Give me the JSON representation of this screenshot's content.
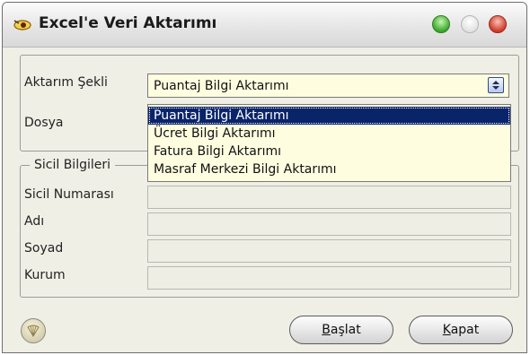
{
  "window": {
    "title": "Excel'e Veri Aktarımı"
  },
  "transfer": {
    "label": "Aktarım Şekli",
    "selected": "Puantaj Bilgi Aktarımı",
    "options": [
      "Puantaj Bilgi Aktarımı",
      "Ücret Bilgi Aktarımı",
      "Fatura Bilgi Aktarımı",
      "Masraf Merkezi Bilgi Aktarımı"
    ]
  },
  "file": {
    "label": "Dosya"
  },
  "registry": {
    "title": "Sicil Bilgileri",
    "fields": [
      {
        "label": "Sicil Numarası",
        "value": ""
      },
      {
        "label": "Adı",
        "value": ""
      },
      {
        "label": "Soyad",
        "value": ""
      },
      {
        "label": "Kurum",
        "value": ""
      }
    ]
  },
  "buttons": {
    "start": {
      "first": "B",
      "rest": "aşlat"
    },
    "close": {
      "first": "K",
      "rest": "apat"
    }
  },
  "icons": {
    "app": "eye-icon",
    "help": "shell-icon"
  }
}
